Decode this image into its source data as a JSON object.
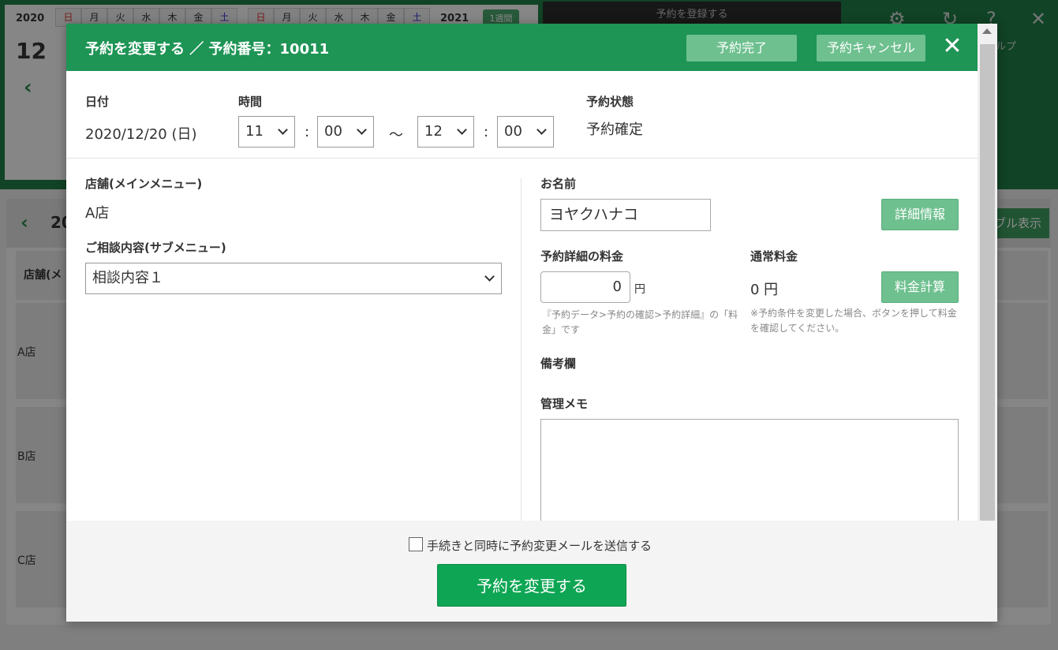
{
  "background": {
    "year_left": "2020",
    "year_right": "2021",
    "month": "12",
    "dow_left": [
      "日",
      "月",
      "火",
      "水",
      "木",
      "金",
      "土"
    ],
    "dow_right": [
      "日",
      "月",
      "火",
      "水",
      "木",
      "金",
      "土"
    ],
    "week_button": "1週間",
    "register_button": "予約を登録する",
    "help_label": "ルプ",
    "schedule_number": "20",
    "table_view_button": "ブル表示",
    "store_column_header": "店舗(メ",
    "rows": [
      "A店",
      "B店",
      "C店"
    ]
  },
  "modal": {
    "title": "予約を変更する ／ 予約番号：10011",
    "complete_button": "予約完了",
    "cancel_button": "予約キャンセル",
    "date_label": "日付",
    "date_value": "2020/12/20 (日)",
    "time_label": "時間",
    "start_hour": "11",
    "start_minute": "00",
    "end_hour": "12",
    "end_minute": "00",
    "colon": ":",
    "tilde": "～",
    "status_label": "予約状態",
    "status_value": "予約確定",
    "store_label": "店舗(メインメニュー)",
    "store_value": "A店",
    "consult_label": "ご相談内容(サブメニュー)",
    "consult_value": "相談内容１",
    "name_label": "お名前",
    "name_value": "ヨヤクハナコ",
    "detail_button": "詳細情報",
    "detail_price_label": "予約詳細の料金",
    "detail_price_value": "0",
    "yen": "円",
    "detail_price_note": "『予約データ>予約の確認>予約詳細』の「料金」です",
    "normal_price_label": "通常料金",
    "normal_price_value": "0 円",
    "calc_button": "料金計算",
    "calc_note": "※予約条件を変更した場合、ボタンを押して料金を確認してください。",
    "remarks_label": "備考欄",
    "memo_label": "管理メモ",
    "memo_value": "",
    "send_mail_label": "手続きと同時に予約変更メールを送信する",
    "submit_button": "予約を変更する"
  }
}
